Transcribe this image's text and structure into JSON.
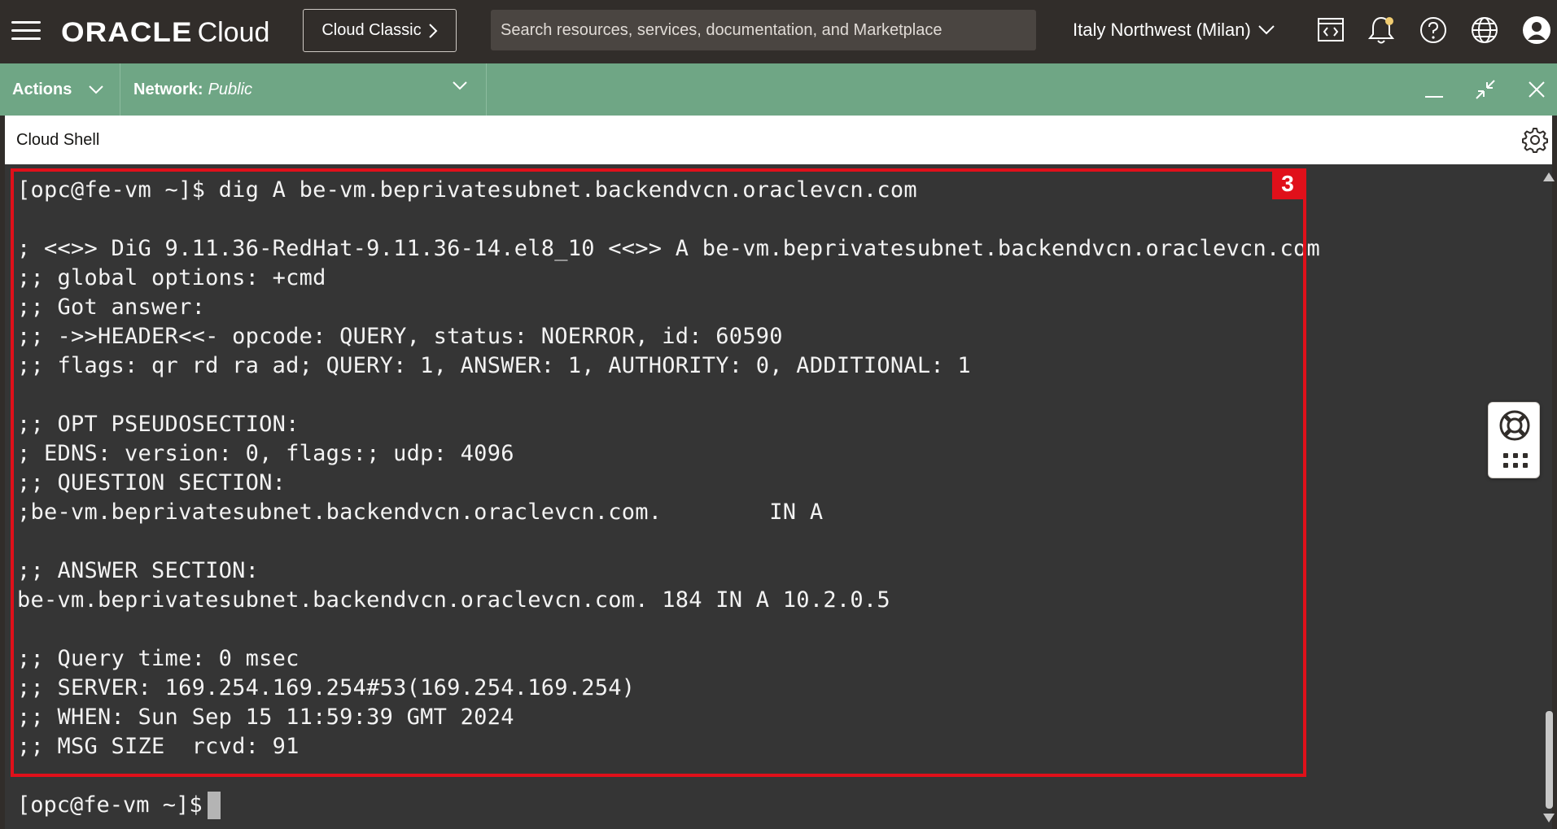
{
  "header": {
    "brand_oracle": "ORACLE",
    "brand_cloud": "Cloud",
    "classic_label": "Cloud Classic",
    "search_placeholder": "Search resources, services, documentation, and Marketplace",
    "region": "Italy Northwest (Milan)",
    "icons": [
      "menu-icon",
      "code-editor-icon",
      "bell-icon",
      "help-icon",
      "globe-icon",
      "user-icon"
    ]
  },
  "shell_toolbar": {
    "actions_label": "Actions",
    "network_label": "Network:",
    "network_value": "Public",
    "icons": [
      "minimize-icon",
      "restore-icon",
      "close-icon"
    ]
  },
  "shell": {
    "title": "Cloud Shell",
    "badge": "3",
    "highlight_color": "#e0101a",
    "lines": [
      "[opc@fe-vm ~]$ dig A be-vm.beprivatesubnet.backendvcn.oraclevcn.com",
      "",
      "; <<>> DiG 9.11.36-RedHat-9.11.36-14.el8_10 <<>> A be-vm.beprivatesubnet.backendvcn.oraclevcn.com",
      ";; global options: +cmd",
      ";; Got answer:",
      ";; ->>HEADER<<- opcode: QUERY, status: NOERROR, id: 60590",
      ";; flags: qr rd ra ad; QUERY: 1, ANSWER: 1, AUTHORITY: 0, ADDITIONAL: 1",
      "",
      ";; OPT PSEUDOSECTION:",
      "; EDNS: version: 0, flags:; udp: 4096",
      ";; QUESTION SECTION:",
      ";be-vm.beprivatesubnet.backendvcn.oraclevcn.com.        IN A",
      "",
      ";; ANSWER SECTION:",
      "be-vm.beprivatesubnet.backendvcn.oraclevcn.com. 184 IN A 10.2.0.5",
      "",
      ";; Query time: 0 msec",
      ";; SERVER: 169.254.169.254#53(169.254.169.254)",
      ";; WHEN: Sun Sep 15 11:59:39 GMT 2024",
      ";; MSG SIZE  rcvd: 91"
    ],
    "prompt": "[opc@fe-vm ~]$"
  },
  "colors": {
    "header_bg": "#312d2a",
    "toolbar_bg": "#6fa685",
    "terminal_bg": "#353535",
    "terminal_fg": "#f3f3f3"
  }
}
